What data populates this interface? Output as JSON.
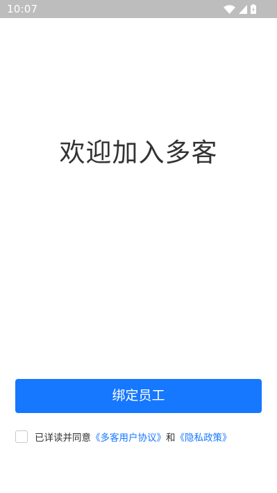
{
  "status_bar": {
    "time": "10:07",
    "icons": [
      "wifi-icon",
      "cellular-signal-icon",
      "battery-charging-icon"
    ]
  },
  "main": {
    "title": "欢迎加入多客"
  },
  "actions": {
    "bind_label": "绑定员工"
  },
  "agreement": {
    "checked": false,
    "prefix": "已详读并同意",
    "user_agreement_link": "《多客用户协议》",
    "conjunction": "和",
    "privacy_policy_link": "《隐私政策》"
  },
  "colors": {
    "accent": "#1677ff",
    "status_bar_bg": "#bdbdbd",
    "title_text": "#333333"
  }
}
